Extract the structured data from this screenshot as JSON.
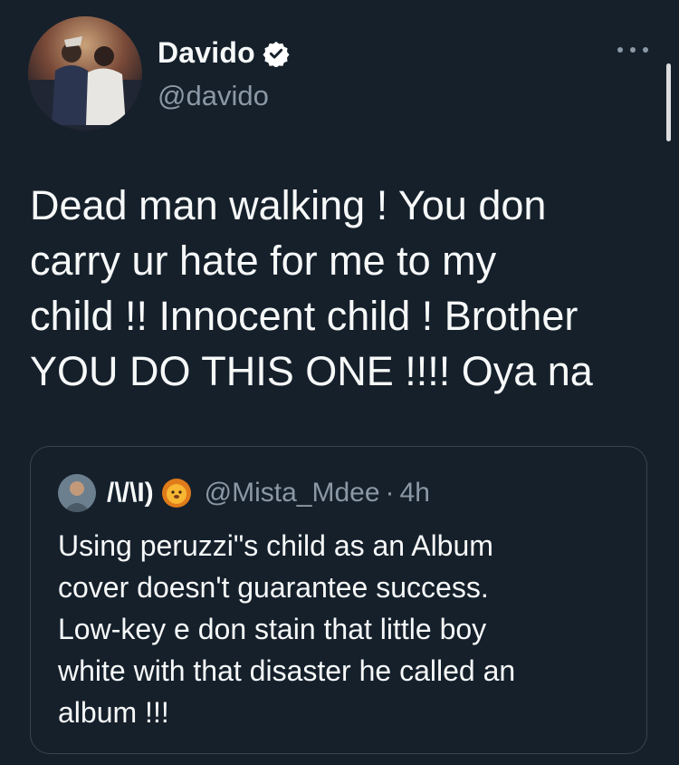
{
  "author": {
    "name": "Davido",
    "handle": "@davido",
    "verified_icon": "verified-badge-icon",
    "avatar": "photo"
  },
  "tweet": {
    "lines": [
      "Dead man walking ! You don",
      "carry ur hate for me to my",
      "child !! Innocent child ! Brother",
      "YOU DO THIS ONE !!!! Oya na"
    ]
  },
  "quoted_tweet": {
    "name": "/\\/\\I)",
    "emoji": "lion-face-emoji",
    "handle": "@Mista_Mdee",
    "separator": "·",
    "time": "4h",
    "lines": [
      "Using peruzzi\"s child as an Album",
      "cover doesn't guarantee success.",
      "Low-key e don stain that little boy",
      "white with that disaster he called an",
      "album !!!"
    ]
  },
  "menu": {
    "icon": "more-options-icon"
  },
  "colors": {
    "background": "#15202b",
    "text": "#f7f9f9",
    "secondary": "#8b98a5",
    "border": "#38444d",
    "verified_fill": "#ffffff"
  }
}
